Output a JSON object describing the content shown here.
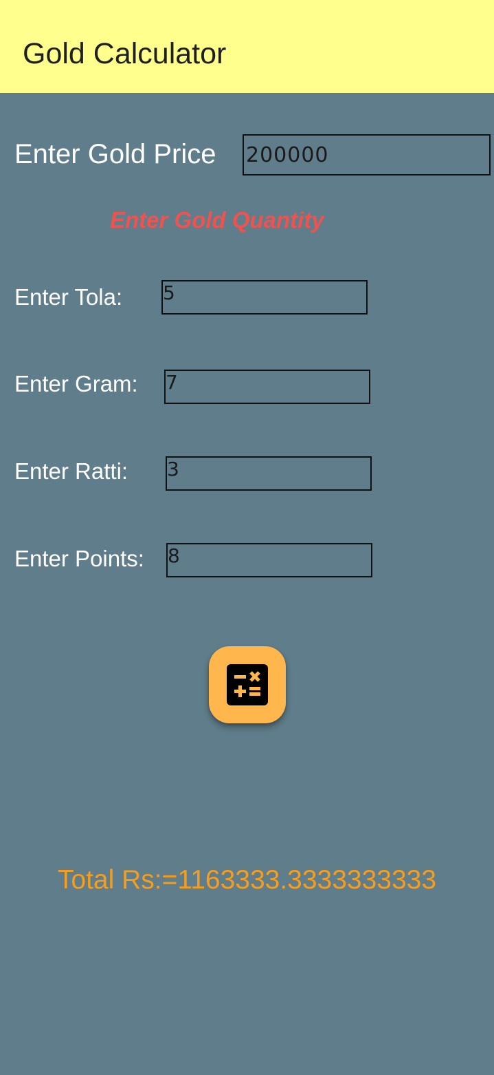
{
  "app_bar": {
    "title": "Gold Calculator",
    "background": "#ffff8d"
  },
  "price": {
    "label": "Enter Gold Price",
    "value": "200000"
  },
  "quantity_heading": "Enter Gold Quantity",
  "fields": {
    "tola": {
      "label": "Enter Tola:",
      "value": "5"
    },
    "gram": {
      "label": "Enter Gram:",
      "value": "7"
    },
    "ratti": {
      "label": "Enter Ratti:",
      "value": "3"
    },
    "points": {
      "label": "Enter Points:",
      "value": "8"
    }
  },
  "calculate_button": {
    "icon": "calculator-icon",
    "color": "#ffb74d"
  },
  "result": {
    "text": "Total Rs:=1163333.3333333333"
  },
  "colors": {
    "background": "#607d8b",
    "heading": "#ef5350",
    "result": "#f59d1e"
  }
}
